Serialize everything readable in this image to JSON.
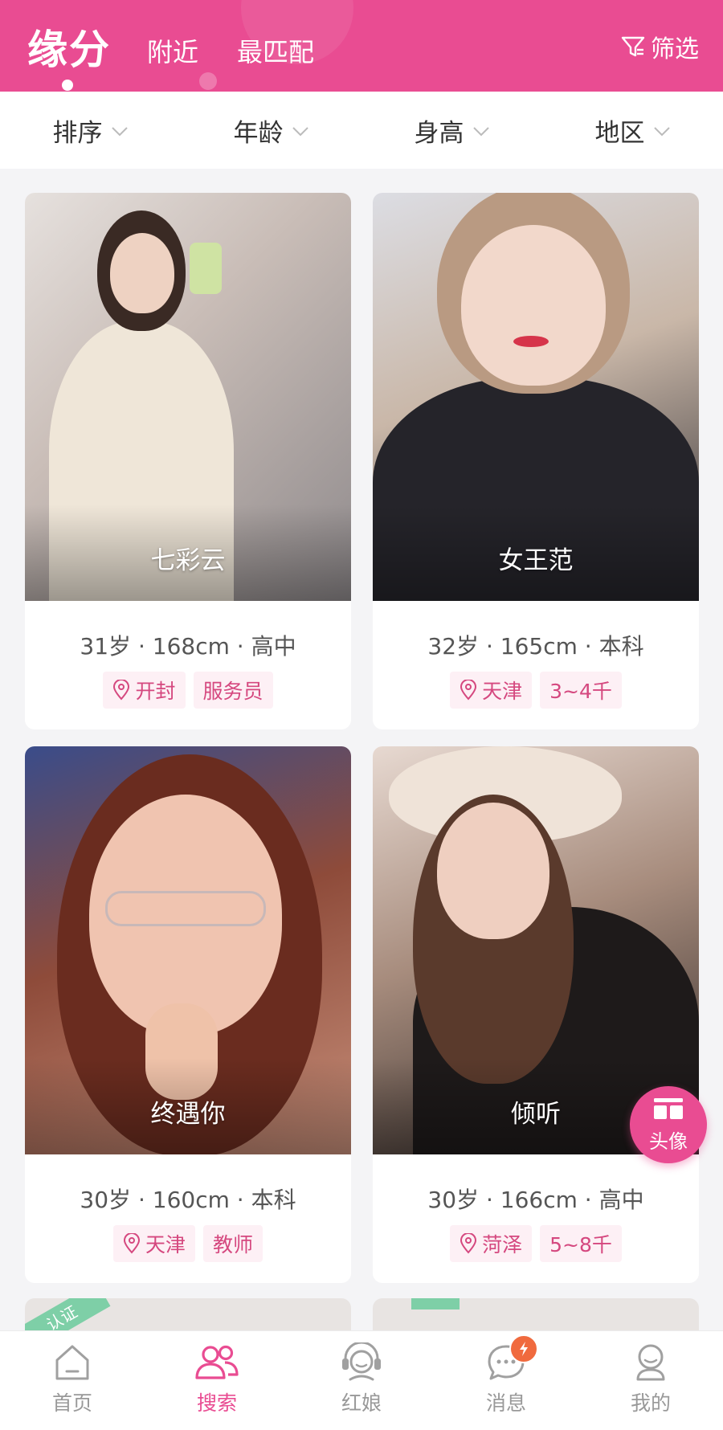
{
  "header": {
    "tabs": [
      {
        "label": "缘分",
        "active": true
      },
      {
        "label": "附近",
        "active": false
      },
      {
        "label": "最匹配",
        "active": false
      }
    ],
    "filter_label": "筛选",
    "accent_color": "#e94c92"
  },
  "filters": [
    {
      "label": "排序"
    },
    {
      "label": "年龄"
    },
    {
      "label": "身高"
    },
    {
      "label": "地区"
    }
  ],
  "cards": [
    {
      "nickname": "七彩云",
      "age": "31岁",
      "height": "168cm",
      "education": "高中",
      "stats": "31岁 · 168cm · 高中",
      "location": "开封",
      "extra_tag": "服务员"
    },
    {
      "nickname": "女王范",
      "age": "32岁",
      "height": "165cm",
      "education": "本科",
      "stats": "32岁 · 165cm · 本科",
      "location": "天津",
      "extra_tag": "3~4千"
    },
    {
      "nickname": "终遇你",
      "age": "30岁",
      "height": "160cm",
      "education": "本科",
      "stats": "30岁 · 160cm · 本科",
      "location": "天津",
      "extra_tag": "教师"
    },
    {
      "nickname": "倾听",
      "age": "30岁",
      "height": "166cm",
      "education": "高中",
      "stats": "30岁 · 166cm · 高中",
      "location": "菏泽",
      "extra_tag": "5~8千"
    }
  ],
  "peek": {
    "ribbon_label": "认证"
  },
  "float_button": {
    "label": "头像"
  },
  "bottom_nav": [
    {
      "label": "首页",
      "icon": "home-icon",
      "active": false
    },
    {
      "label": "搜索",
      "icon": "people-icon",
      "active": true
    },
    {
      "label": "红娘",
      "icon": "headset-icon",
      "active": false
    },
    {
      "label": "消息",
      "icon": "chat-icon",
      "active": false
    },
    {
      "label": "我的",
      "icon": "profile-icon",
      "active": false
    }
  ]
}
